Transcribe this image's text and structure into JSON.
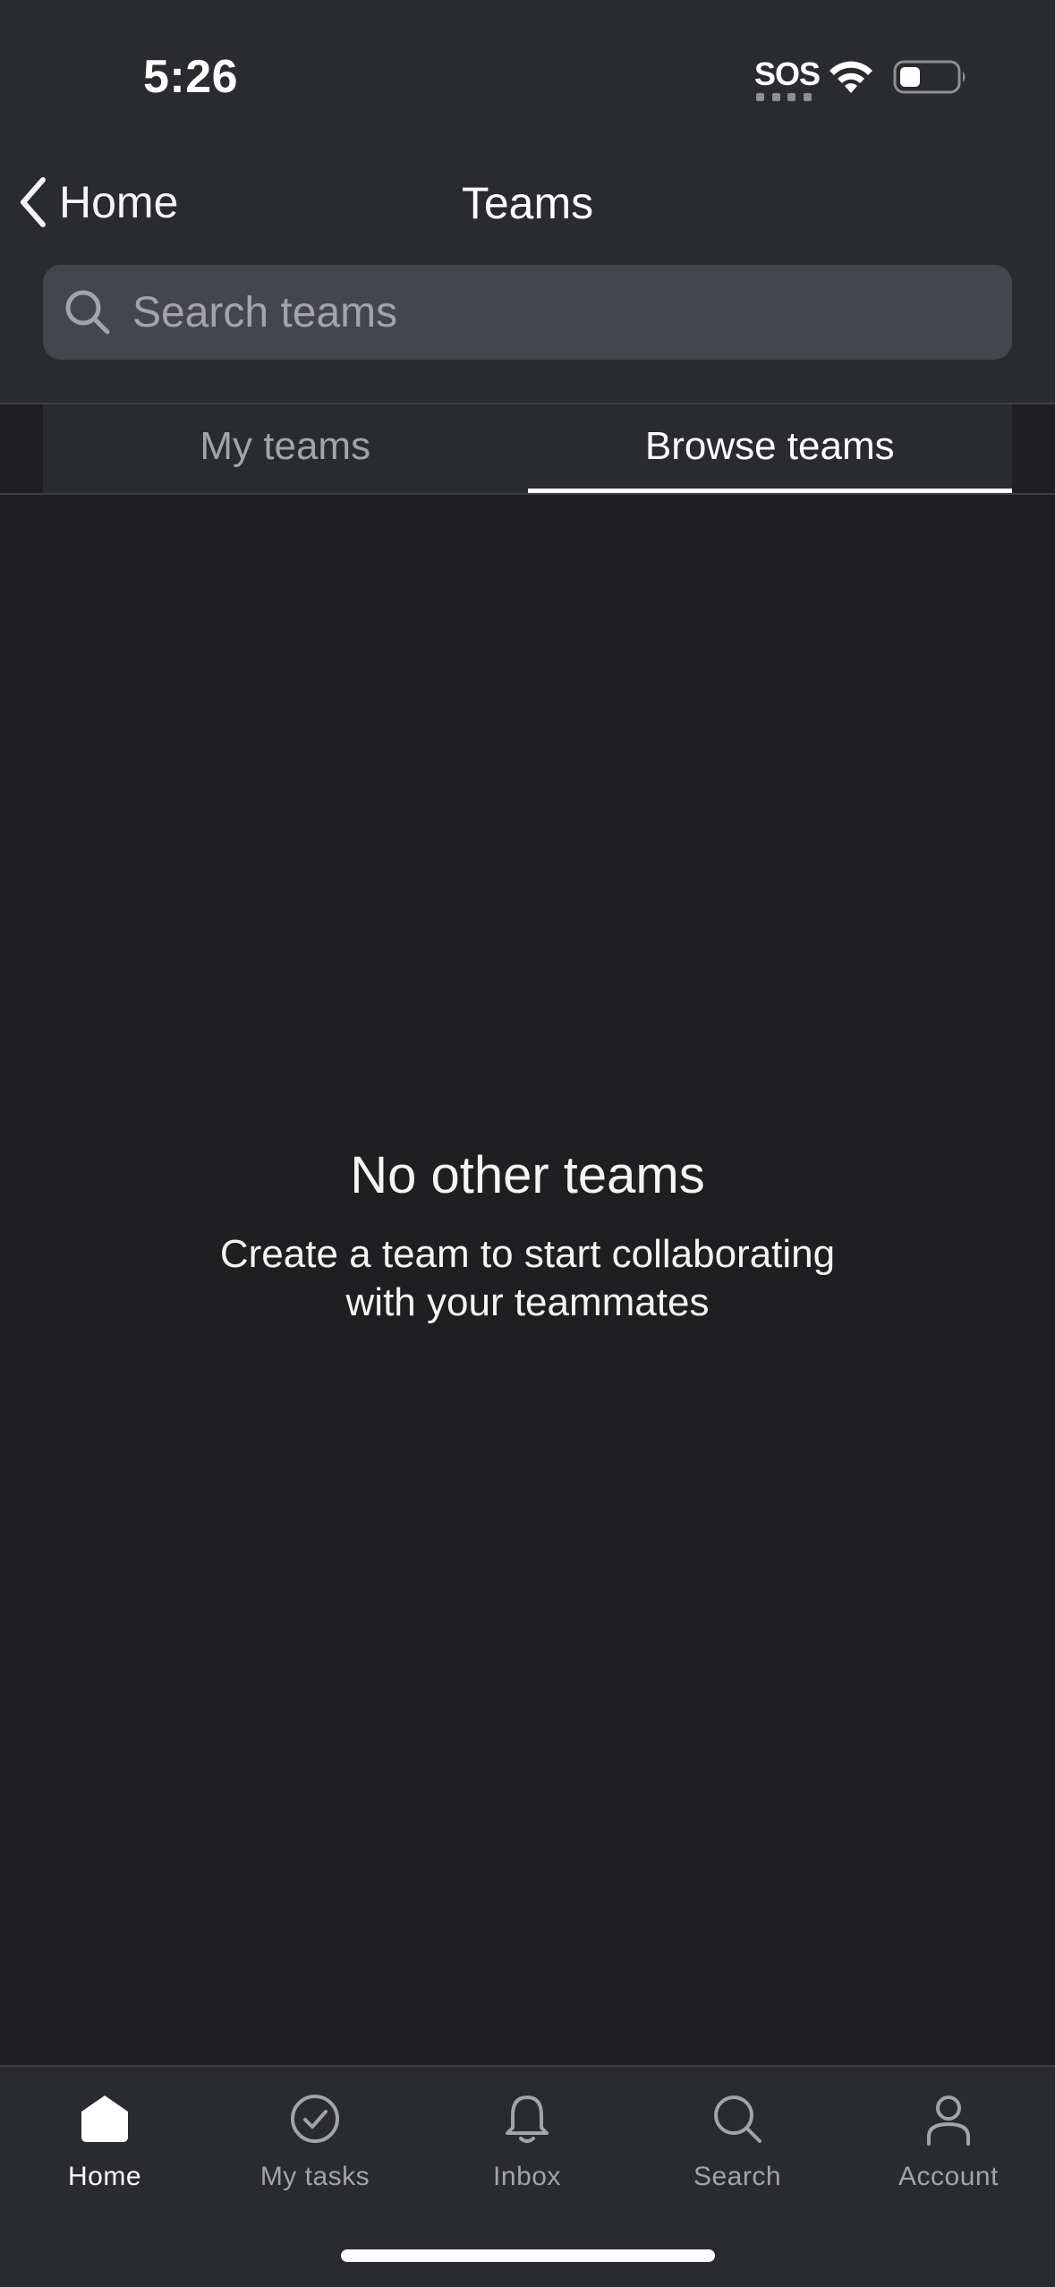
{
  "status_bar": {
    "time": "5:26",
    "sos": "SOS",
    "icons": [
      "wifi-icon",
      "battery-icon"
    ]
  },
  "nav": {
    "back_label": "Home",
    "title": "Teams"
  },
  "search": {
    "placeholder": "Search teams",
    "value": ""
  },
  "tabs": [
    {
      "label": "My teams",
      "selected": false
    },
    {
      "label": "Browse teams",
      "selected": true
    }
  ],
  "empty_state": {
    "title": "No other teams",
    "body": "Create a team to start collaborating with your teammates"
  },
  "tabbar": [
    {
      "label": "Home",
      "icon": "home-icon",
      "selected": true
    },
    {
      "label": "My tasks",
      "icon": "check-circle-icon",
      "selected": false
    },
    {
      "label": "Inbox",
      "icon": "bell-icon",
      "selected": false
    },
    {
      "label": "Search",
      "icon": "search-icon",
      "selected": false
    },
    {
      "label": "Account",
      "icon": "person-icon",
      "selected": false
    }
  ],
  "colors": {
    "background": "#1f1f21",
    "header": "#2a2b2f",
    "search_field": "#45464c",
    "muted_text": "#a3a4a9",
    "active_text": "#ffffff"
  }
}
